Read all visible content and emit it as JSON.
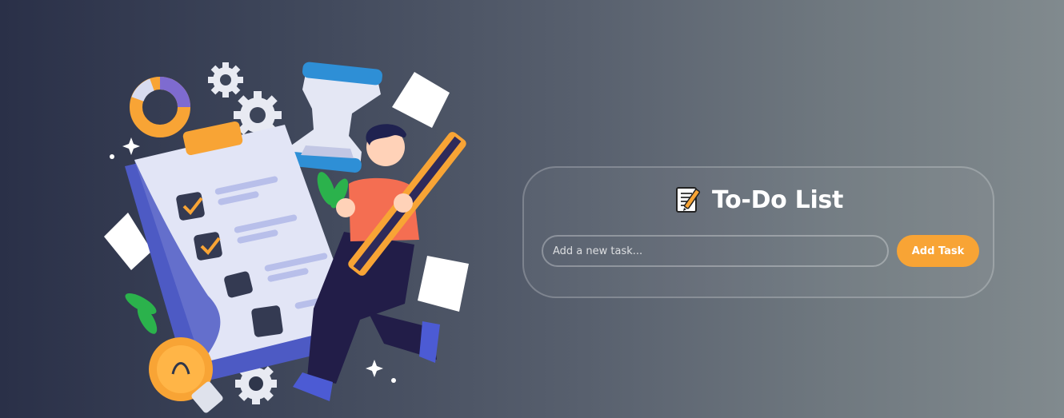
{
  "app": {
    "title": "To-Do List",
    "title_icon": "memo-icon"
  },
  "form": {
    "input_placeholder": "Add a new task...",
    "input_value": "",
    "add_button_label": "Add Task"
  },
  "colors": {
    "accent": "#f8a435",
    "background_left": "#2a3048",
    "background_right": "#818a8e"
  },
  "illustration": {
    "icon": "checklist-illustration"
  }
}
